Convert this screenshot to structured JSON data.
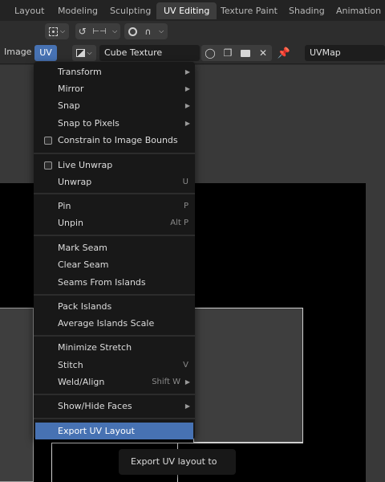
{
  "workspace_tabs": [
    "Layout",
    "Modeling",
    "Sculpting",
    "UV Editing",
    "Texture Paint",
    "Shading",
    "Animation"
  ],
  "active_tab": "UV Editing",
  "header": {
    "image_menu": "Image",
    "uv_menu": "UV",
    "image_name": "Cube Texture",
    "uv_map": "UVMap"
  },
  "icons": {
    "pivot": "pivot-icon",
    "sync": "sync-selection-icon",
    "snap": "snap-icon",
    "proportional": "proportional-edit-icon",
    "falloff": "falloff-icon",
    "image": "image-icon",
    "fake_user": "shield-icon",
    "duplicate": "duplicate-icon",
    "open": "folder-icon",
    "unlink": "close-icon",
    "pin": "pin-icon"
  },
  "menu": {
    "transform": "Transform",
    "mirror": "Mirror",
    "snap": "Snap",
    "snap_to_pixels": "Snap to Pixels",
    "constrain": "Constrain to Image Bounds",
    "live_unwrap": "Live Unwrap",
    "unwrap": "Unwrap",
    "unwrap_sc": "U",
    "pin": "Pin",
    "pin_sc": "P",
    "unpin": "Unpin",
    "unpin_sc": "Alt P",
    "mark_seam": "Mark Seam",
    "clear_seam": "Clear Seam",
    "seams_from_islands": "Seams From Islands",
    "pack_islands": "Pack Islands",
    "average_islands_scale": "Average Islands Scale",
    "minimize_stretch": "Minimize Stretch",
    "stitch": "Stitch",
    "stitch_sc": "V",
    "weld_align": "Weld/Align",
    "weld_align_sc": "Shift W",
    "show_hide_faces": "Show/Hide Faces",
    "export_uv_layout": "Export UV Layout"
  },
  "tooltip": "Export UV layout to file.",
  "colors": {
    "accent": "#4772b3",
    "menu_bg": "#181818",
    "panel_bg": "#2d2d2d"
  }
}
